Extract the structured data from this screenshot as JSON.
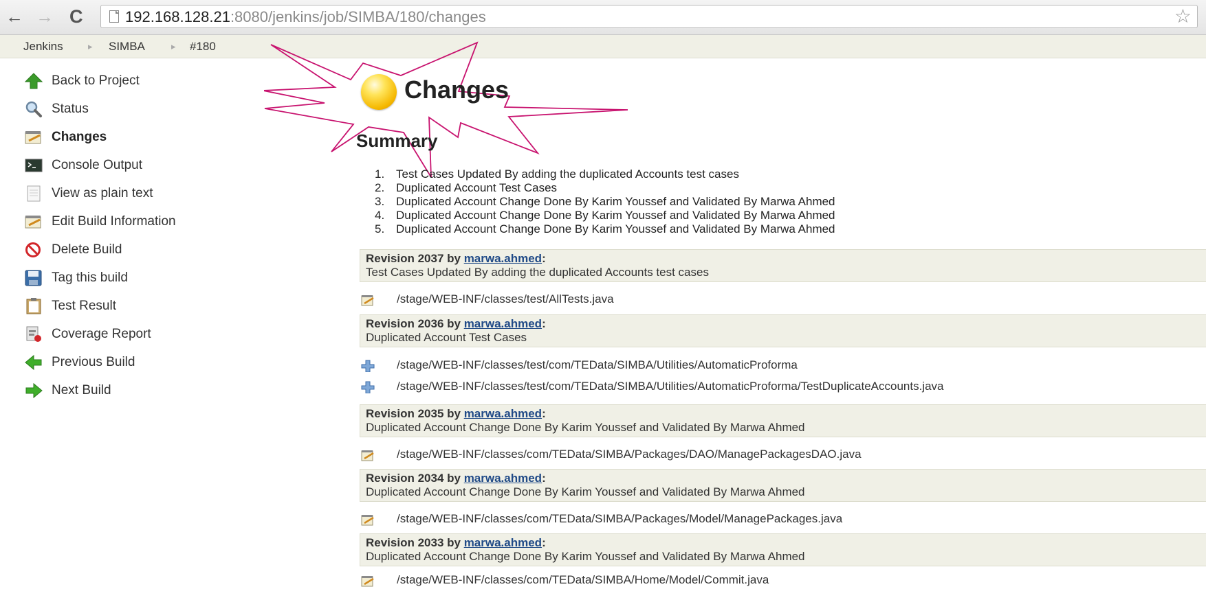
{
  "browser": {
    "url_host": "192.168.128.21",
    "url_rest": ":8080/jenkins/job/SIMBA/180/changes"
  },
  "breadcrumb": {
    "items": [
      {
        "label": "Jenkins"
      },
      {
        "label": "SIMBA"
      },
      {
        "label": "#180"
      }
    ],
    "separator": "▸"
  },
  "sidebar": {
    "items": [
      {
        "label": "Back to Project",
        "icon": "up-arrow-icon"
      },
      {
        "label": "Status",
        "icon": "magnifier-icon"
      },
      {
        "label": "Changes",
        "icon": "notepad-icon",
        "active": true
      },
      {
        "label": "Console Output",
        "icon": "terminal-icon"
      },
      {
        "label": "View as plain text",
        "icon": "document-icon"
      },
      {
        "label": "Edit Build Information",
        "icon": "notepad-edit-icon"
      },
      {
        "label": "Delete Build",
        "icon": "no-entry-icon"
      },
      {
        "label": "Tag this build",
        "icon": "floppy-disk-icon"
      },
      {
        "label": "Test Result",
        "icon": "clipboard-icon"
      },
      {
        "label": "Coverage Report",
        "icon": "coverage-report-icon"
      },
      {
        "label": "Previous Build",
        "icon": "left-arrow-icon"
      },
      {
        "label": "Next Build",
        "icon": "right-arrow-icon"
      }
    ]
  },
  "main": {
    "title": "Changes",
    "summary_title": "Summary",
    "summary": [
      {
        "num": "1.",
        "text": "Test Cases Updated By adding the duplicated Accounts test cases"
      },
      {
        "num": "2.",
        "text": "Duplicated Account Test Cases"
      },
      {
        "num": "3.",
        "text": "Duplicated Account Change Done By Karim Youssef and Validated By Marwa Ahmed"
      },
      {
        "num": "4.",
        "text": "Duplicated Account Change Done By Karim Youssef and Validated By Marwa Ahmed"
      },
      {
        "num": "5.",
        "text": "Duplicated Account Change Done By Karim Youssef and Validated By Marwa Ahmed"
      }
    ],
    "revisions": [
      {
        "label": "Revision 2037 by ",
        "author": "marwa.ahmed",
        "colon": ":",
        "message": "Test Cases Updated By adding the duplicated Accounts test cases",
        "files": [
          {
            "type": "edit",
            "path": "/stage/WEB-INF/classes/test/AllTests.java"
          }
        ]
      },
      {
        "label": "Revision 2036 by ",
        "author": "marwa.ahmed",
        "colon": ":",
        "message": "Duplicated Account Test Cases",
        "files": [
          {
            "type": "add",
            "path": "/stage/WEB-INF/classes/test/com/TEData/SIMBA/Utilities/AutomaticProforma"
          },
          {
            "type": "add",
            "path": "/stage/WEB-INF/classes/test/com/TEData/SIMBA/Utilities/AutomaticProforma/TestDuplicateAccounts.java"
          }
        ]
      },
      {
        "label": "Revision 2035 by ",
        "author": "marwa.ahmed",
        "colon": ":",
        "message": "Duplicated Account Change Done By Karim Youssef and Validated By Marwa Ahmed",
        "files": [
          {
            "type": "edit",
            "path": "/stage/WEB-INF/classes/com/TEData/SIMBA/Packages/DAO/ManagePackagesDAO.java"
          }
        ]
      },
      {
        "label": "Revision 2034 by ",
        "author": "marwa.ahmed",
        "colon": ":",
        "message": "Duplicated Account Change Done By Karim Youssef and Validated By Marwa Ahmed",
        "files": [
          {
            "type": "edit",
            "path": "/stage/WEB-INF/classes/com/TEData/SIMBA/Packages/Model/ManagePackages.java"
          }
        ]
      },
      {
        "label": "Revision 2033 by ",
        "author": "marwa.ahmed",
        "colon": ":",
        "message": "Duplicated Account Change Done By Karim Youssef and Validated By Marwa Ahmed",
        "files": [
          {
            "type": "edit",
            "path": "/stage/WEB-INF/classes/com/TEData/SIMBA/Home/Model/Commit.java"
          }
        ]
      }
    ]
  },
  "colors": {
    "breadcrumb_bg": "#f0f0e6",
    "revision_bg": "#f0f0e6",
    "link": "#204a87",
    "annotation_burst": "#c8136f"
  }
}
